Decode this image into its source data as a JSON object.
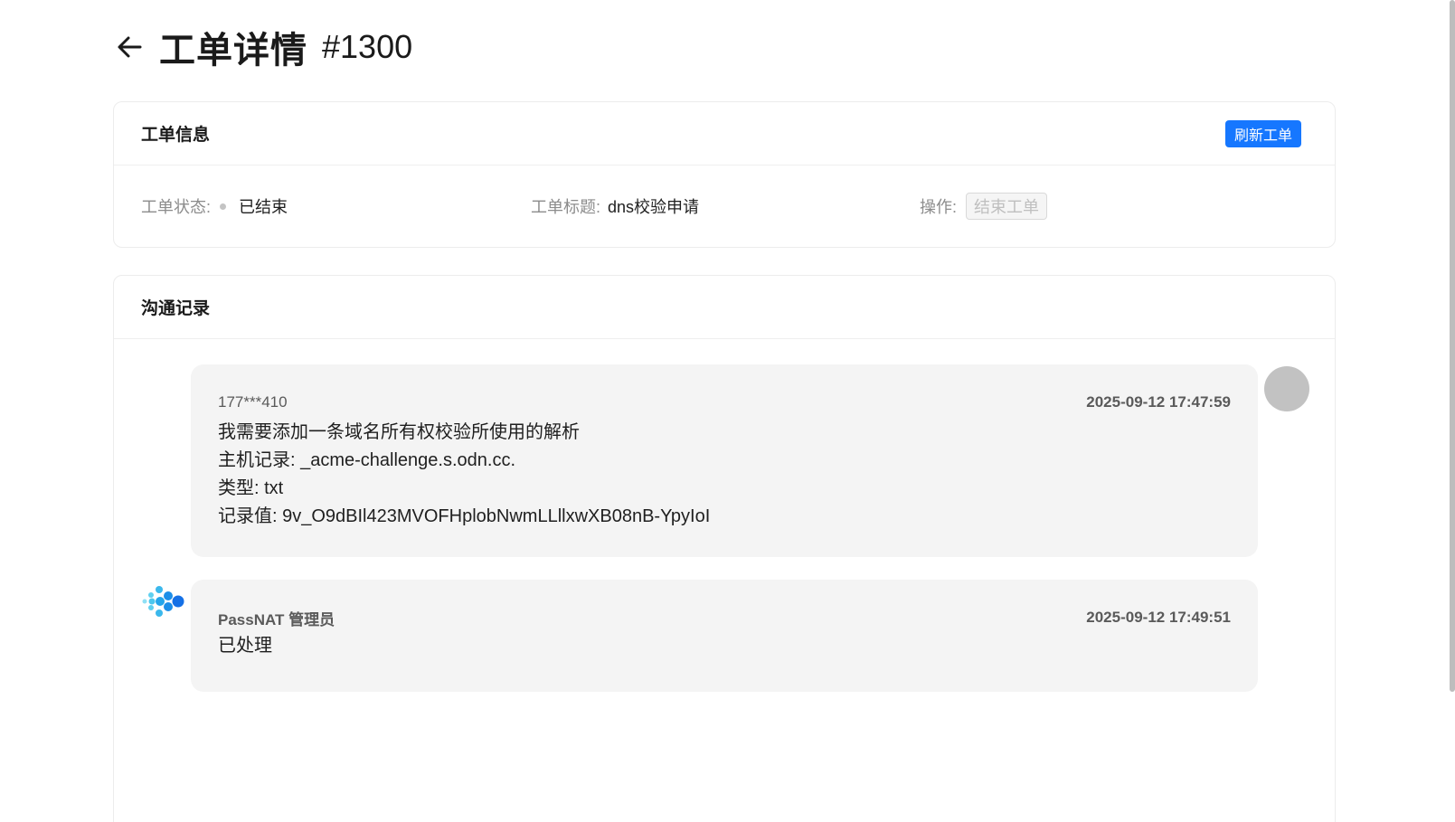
{
  "header": {
    "title": "工单详情",
    "ticket_number": "#1300"
  },
  "ticket_info": {
    "section_title": "工单信息",
    "refresh_label": "刷新工单",
    "status_label": "工单状态:",
    "status_value": "已结束",
    "subject_label": "工单标题:",
    "subject_value": "dns校验申请",
    "action_label": "操作:",
    "close_label": "结束工单"
  },
  "communication": {
    "section_title": "沟通记录",
    "messages": [
      {
        "sender": "177***410",
        "time": "2025-09-12 17:47:59",
        "lines": [
          "我需要添加一条域名所有权校验所使用的解析",
          "主机记录: _acme-challenge.s.odn.cc.",
          "类型: txt",
          "记录值: 9v_O9dBIl423MVOFHplobNwmLLllxwXB08nB-YpyIoI"
        ]
      },
      {
        "sender": "PassNAT 管理员",
        "time": "2025-09-12 17:49:51",
        "lines": [
          "已处理"
        ]
      }
    ]
  },
  "colors": {
    "primary": "#1677ff",
    "bubble": "#f4f4f4",
    "status_dot": "#c4c4c4"
  },
  "icons": {
    "back": "arrow-left-icon",
    "admin_logo": "passnat-logo-icon",
    "user_avatar": "user-avatar"
  }
}
